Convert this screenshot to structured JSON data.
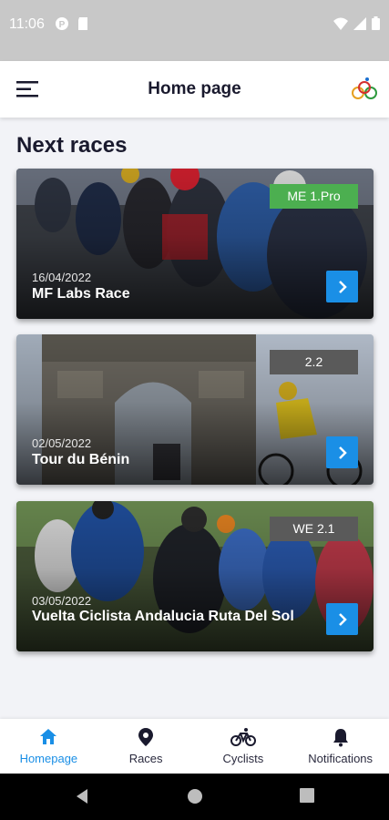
{
  "status_bar": {
    "time": "11:06"
  },
  "app_bar": {
    "title": "Home page"
  },
  "section": {
    "title": "Next races"
  },
  "races": [
    {
      "badge": "ME 1.Pro",
      "badge_color": "#4caf50",
      "date": "16/04/2022",
      "name": "MF Labs Race"
    },
    {
      "badge": "2.2",
      "badge_color": "#5a5a5a",
      "date": "02/05/2022",
      "name": "Tour du Bénin"
    },
    {
      "badge": "WE 2.1",
      "badge_color": "#5a5a5a",
      "date": "03/05/2022",
      "name": "Vuelta Ciclista Andalucia Ruta Del Sol"
    }
  ],
  "bottom_nav": {
    "items": [
      {
        "label": "Homepage",
        "icon": "home-icon",
        "active": true
      },
      {
        "label": "Races",
        "icon": "location-pin-icon",
        "active": false
      },
      {
        "label": "Cyclists",
        "icon": "bicycle-icon",
        "active": false
      },
      {
        "label": "Notifications",
        "icon": "bell-icon",
        "active": false
      }
    ]
  },
  "colors": {
    "accent": "#1a8fe6",
    "badge_green": "#4caf50",
    "badge_gray": "#5a5a5a",
    "text_dark": "#1a1a2e"
  }
}
